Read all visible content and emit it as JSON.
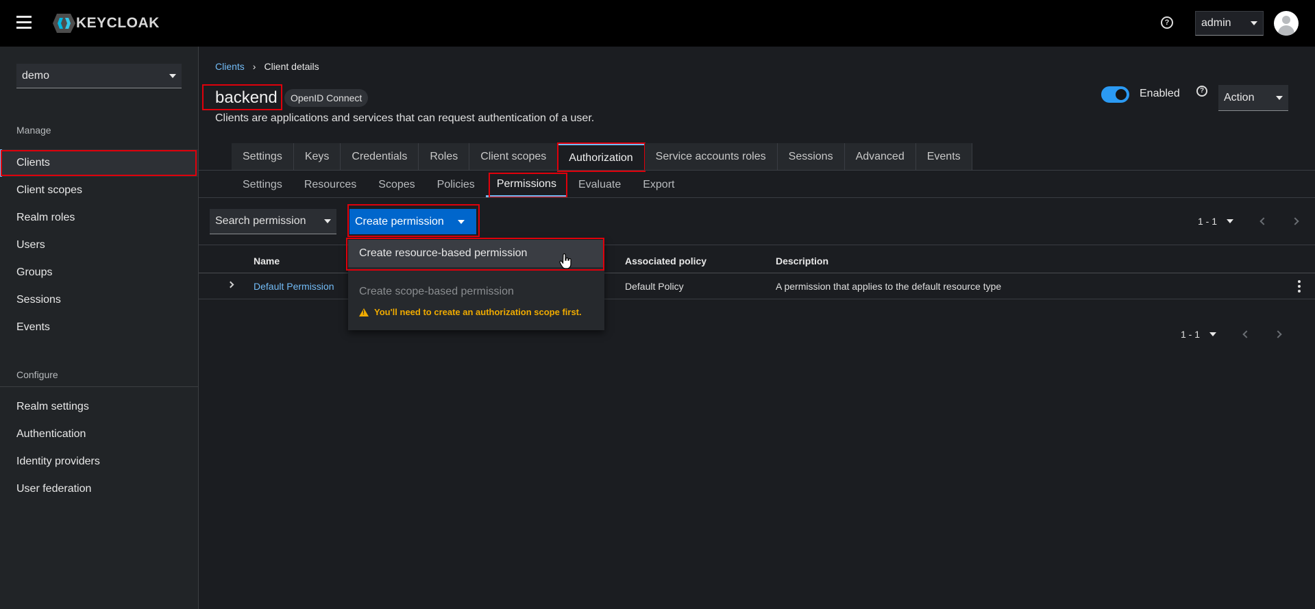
{
  "app": {
    "logo_text": "KEYCLOAK",
    "user": "admin"
  },
  "sidebar": {
    "realm": "demo",
    "manage_label": "Manage",
    "manage_items": [
      {
        "label": "Clients",
        "active": true
      },
      {
        "label": "Client scopes"
      },
      {
        "label": "Realm roles"
      },
      {
        "label": "Users"
      },
      {
        "label": "Groups"
      },
      {
        "label": "Sessions"
      },
      {
        "label": "Events"
      }
    ],
    "configure_label": "Configure",
    "configure_items": [
      {
        "label": "Realm settings"
      },
      {
        "label": "Authentication"
      },
      {
        "label": "Identity providers"
      },
      {
        "label": "User federation"
      }
    ]
  },
  "breadcrumb": {
    "parent": "Clients",
    "current": "Client details"
  },
  "client": {
    "name": "backend",
    "protocol": "OpenID Connect",
    "description": "Clients are applications and services that can request authentication of a user.",
    "enabled_label": "Enabled",
    "enabled": true,
    "action_label": "Action"
  },
  "tabs": [
    "Settings",
    "Keys",
    "Credentials",
    "Roles",
    "Client scopes",
    "Authorization",
    "Service accounts roles",
    "Sessions",
    "Advanced",
    "Events"
  ],
  "active_tab": "Authorization",
  "subtabs": [
    "Settings",
    "Resources",
    "Scopes",
    "Policies",
    "Permissions",
    "Evaluate",
    "Export"
  ],
  "active_subtab": "Permissions",
  "toolbar": {
    "search_label": "Search permission",
    "create_label": "Create permission",
    "pagination": "1 - 1"
  },
  "table": {
    "columns": {
      "name": "Name",
      "policy": "Associated policy",
      "description": "Description"
    },
    "rows": [
      {
        "name": "Default Permission",
        "policy": "Default Policy",
        "description": "A permission that applies to the default resource type"
      }
    ]
  },
  "menu": {
    "resource_based": "Create resource-based permission",
    "scope_based": "Create scope-based permission",
    "scope_warning": "You'll need to create an authorization scope first."
  },
  "colors": {
    "accent": "#73bcf7",
    "primary": "#0066cc",
    "warning": "#f0ab00",
    "highlight": "#e0000b"
  }
}
